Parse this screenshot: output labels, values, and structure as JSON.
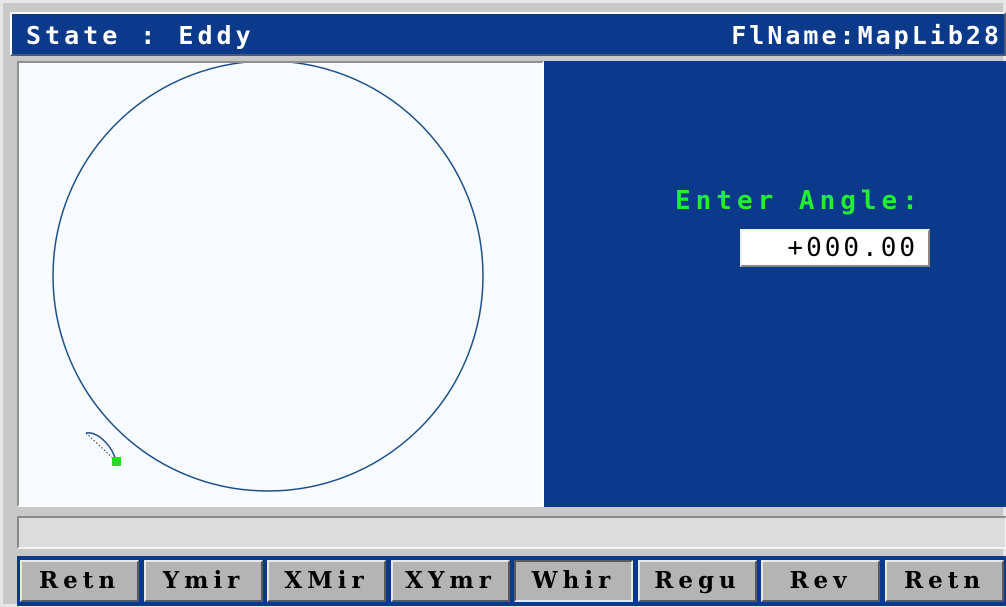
{
  "header": {
    "state_text": "State : Eddy",
    "file_text": "FlName:MapLib28"
  },
  "panel": {
    "angle_label": "Enter Angle:",
    "angle_value": "+000.00"
  },
  "status_bar": {
    "text": ""
  },
  "softkeys": [
    {
      "label": "Retn"
    },
    {
      "label": "Ymir"
    },
    {
      "label": "XMir"
    },
    {
      "label": "XYmr"
    },
    {
      "label": "Whir"
    },
    {
      "label": "Regu"
    },
    {
      "label": "Rev"
    },
    {
      "label": "Retn"
    }
  ],
  "colors": {
    "screen_blue": "#0b3a8b",
    "label_green": "#22ee33",
    "path_stroke": "#1d4f8a",
    "marker_green": "#22dd22"
  }
}
